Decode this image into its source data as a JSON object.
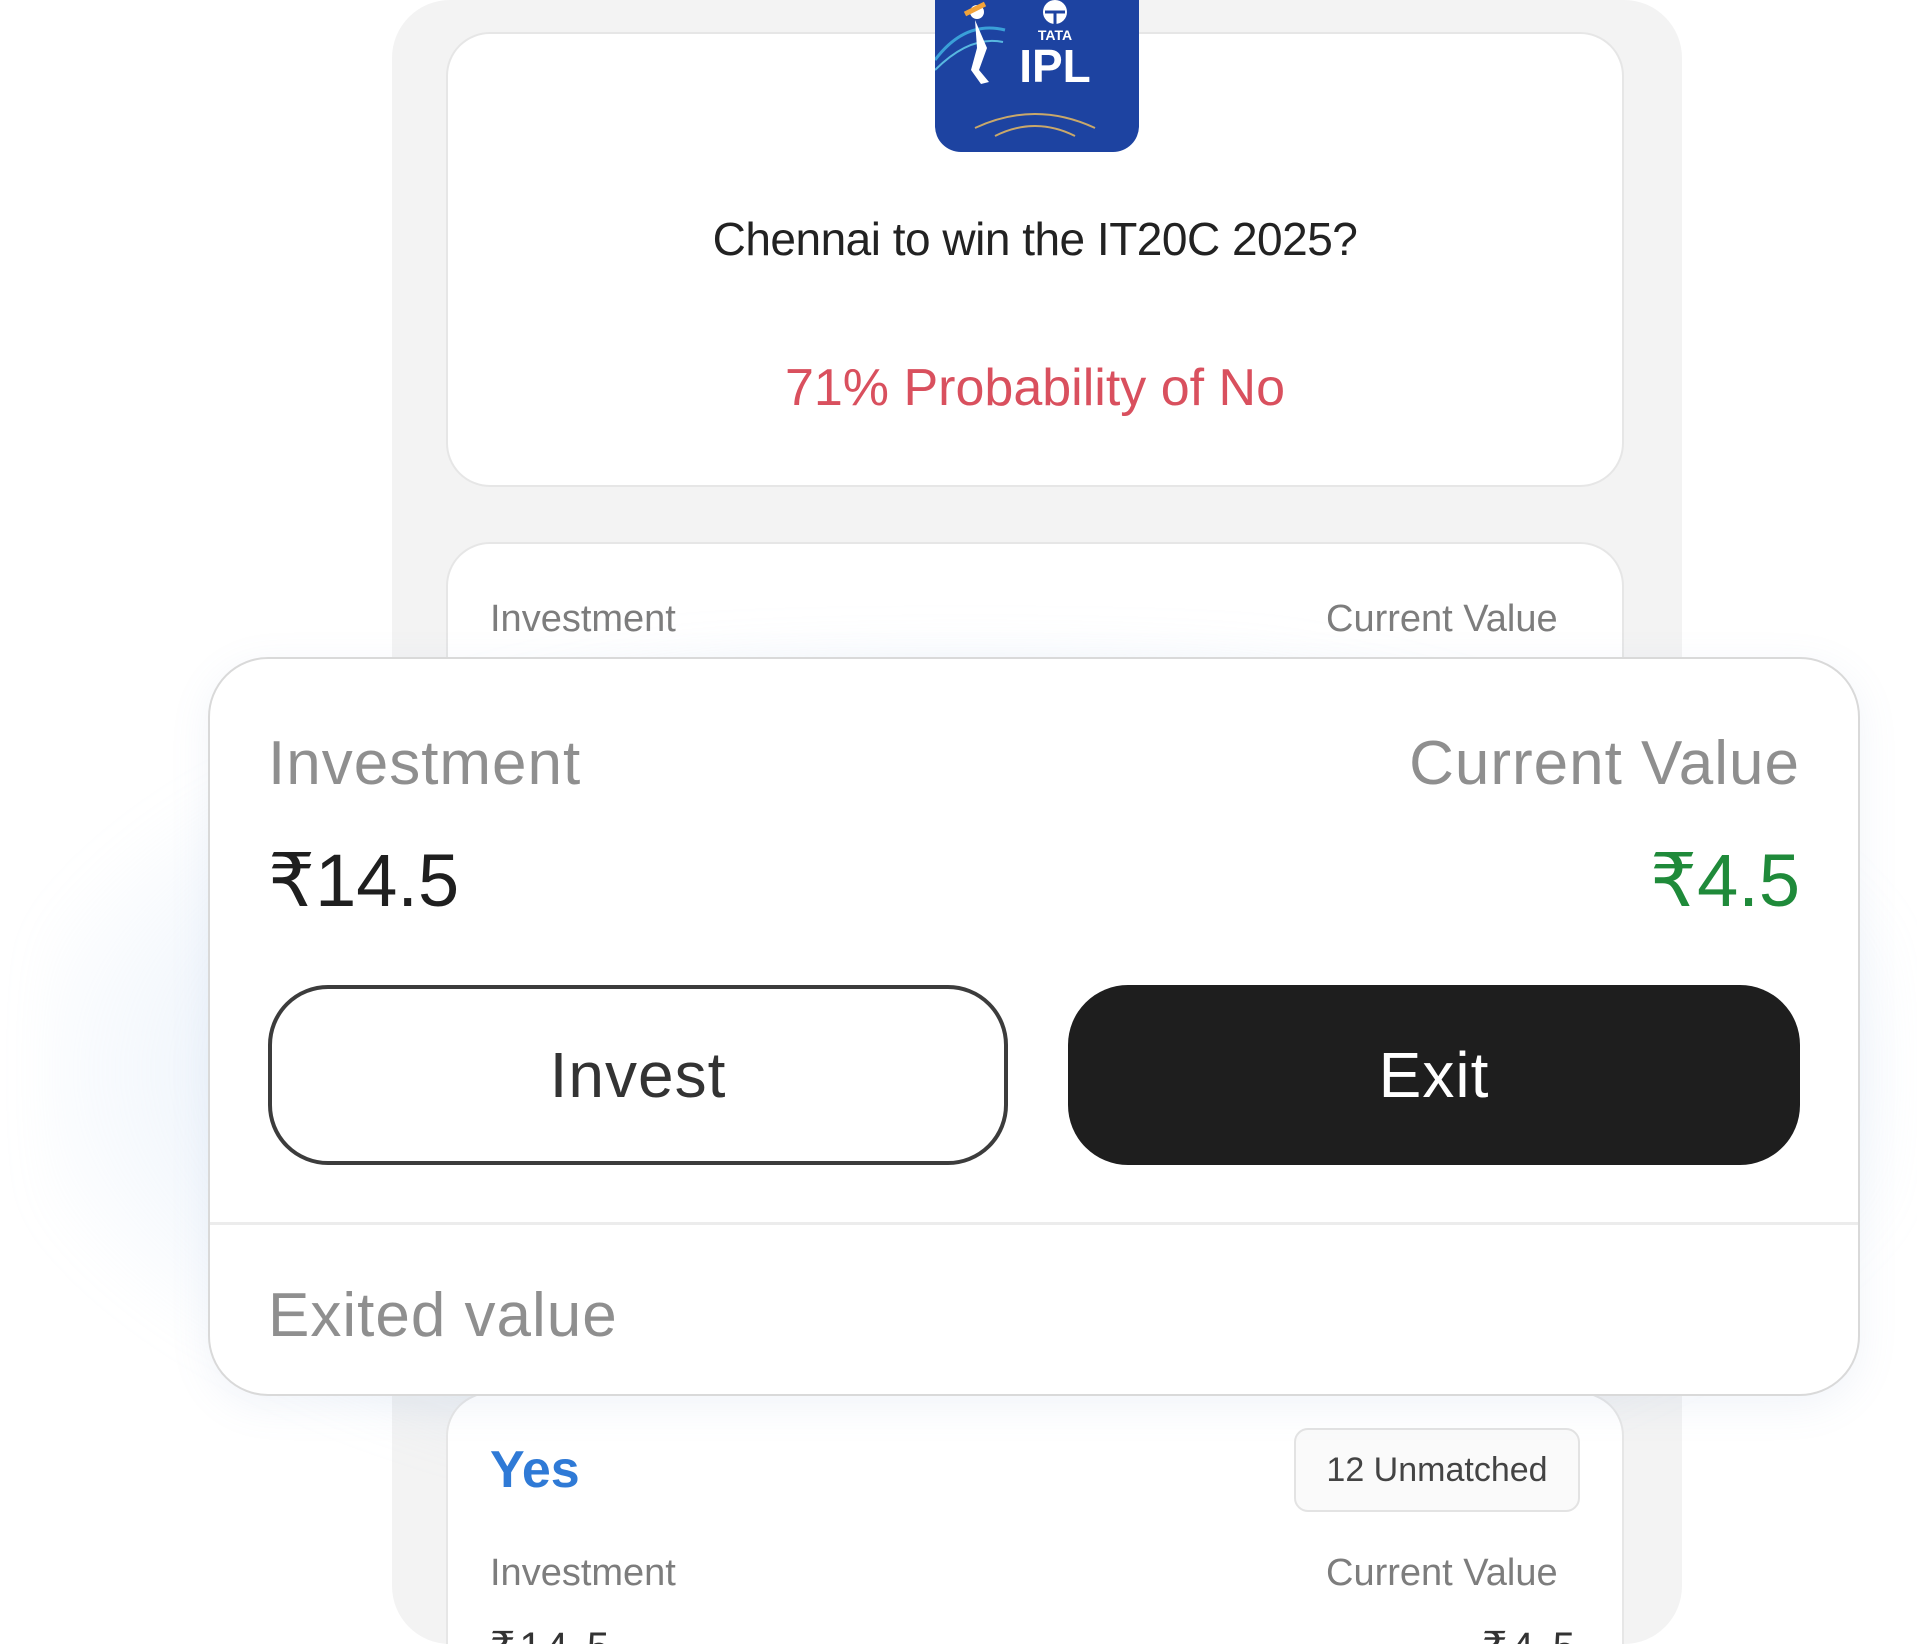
{
  "match_card": {
    "logo_text_top": "TATA",
    "logo_text_main": "IPL",
    "question": "Chennai to win the IT20C 2025?",
    "probability": "71% Probability of No"
  },
  "background_card": {
    "investment_label": "Investment",
    "current_value_label": "Current Value"
  },
  "position_popup": {
    "investment_label": "Investment",
    "current_value_label": "Current Value",
    "investment_value": "₹14.5",
    "current_value": "₹4.5",
    "invest_button": "Invest",
    "exit_button": "Exit",
    "exited_value_label": "Exited value"
  },
  "yes_card": {
    "side_label": "Yes",
    "unmatched_badge": "12 Unmatched",
    "investment_label": "Investment",
    "current_value_label": "Current Value",
    "investment_value_partial": "₹14.5",
    "current_value_partial": "₹4.5"
  },
  "colors": {
    "probability_no": "#d9505e",
    "current_value_positive": "#1f8a3a",
    "yes_blue": "#2f7ad6",
    "logo_blue": "#1d43a1",
    "exit_button_bg": "#1e1e1e"
  }
}
